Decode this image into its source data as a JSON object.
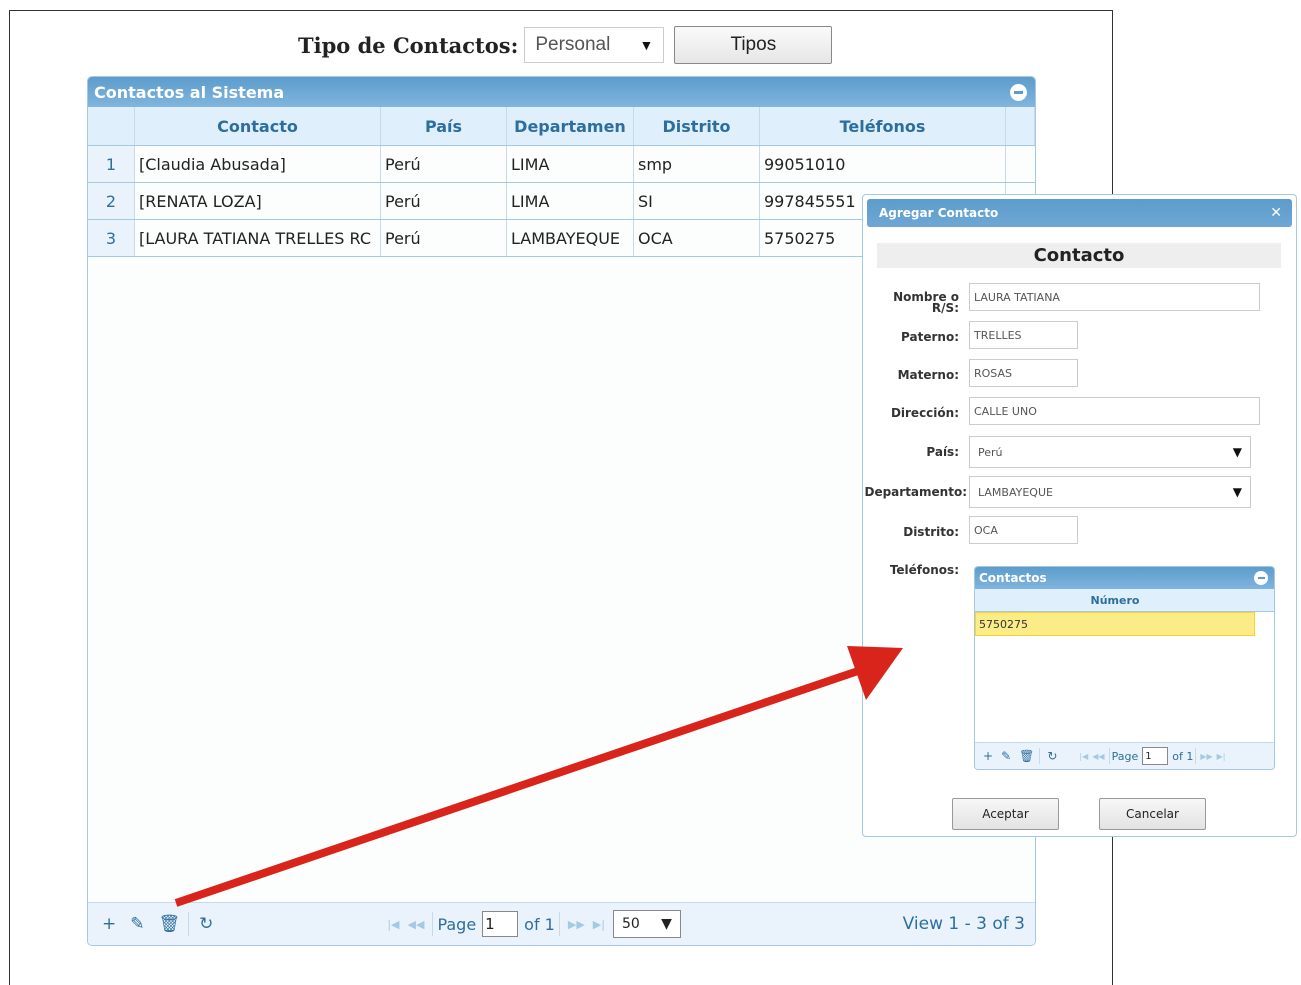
{
  "type_bar": {
    "label": "Tipo de Contactos:",
    "select_value": "Personal",
    "button": "Tipos"
  },
  "grid": {
    "caption": "Contactos al Sistema",
    "columns": [
      "Contacto",
      "País",
      "Departamen",
      "Distrito",
      "Teléfonos"
    ],
    "rows": [
      {
        "n": "1",
        "contacto": "[Claudia Abusada]",
        "pais": "Perú",
        "dep": "LIMA",
        "dist": "smp",
        "tel": "99051010"
      },
      {
        "n": "2",
        "contacto": "[RENATA LOZA]",
        "pais": "Perú",
        "dep": "LIMA",
        "dist": "SI",
        "tel": "997845551"
      },
      {
        "n": "3",
        "contacto": "[LAURA TATIANA TRELLES RC",
        "pais": "Perú",
        "dep": "LAMBAYEQUE",
        "dist": "OCA",
        "tel": "5750275"
      }
    ],
    "pager": {
      "page_label": "Page",
      "page_value": "1",
      "of_label": "of 1",
      "rows_value": "50",
      "view_text": "View 1 - 3 of 3"
    }
  },
  "dialog": {
    "title": "Agregar Contacto",
    "form_title": "Contacto",
    "labels": {
      "nombre_1": "Nombre o",
      "nombre_2": "R/S:",
      "paterno": "Paterno:",
      "materno": "Materno:",
      "direccion": "Dirección:",
      "pais": "País:",
      "departamento": "Departamento:",
      "distrito": "Distrito:",
      "telefonos": "Teléfonos:"
    },
    "values": {
      "nombre": "LAURA TATIANA",
      "paterno": "TRELLES",
      "materno": "ROSAS",
      "direccion": "CALLE UNO",
      "pais": "Perú",
      "departamento": "LAMBAYEQUE",
      "distrito": "OCA"
    },
    "phones": {
      "caption": "Contactos",
      "column": "Número",
      "rows": [
        "5750275"
      ],
      "pager": {
        "page_label": "Page",
        "page_value": "1",
        "of_label": "of 1"
      }
    },
    "buttons": {
      "accept": "Aceptar",
      "cancel": "Cancelar"
    }
  },
  "colors": {
    "header_blue": "#5c9ccc",
    "header_text": "#2e6e9e",
    "highlight_row": "#fbec88",
    "arrow": "#d9241b"
  }
}
